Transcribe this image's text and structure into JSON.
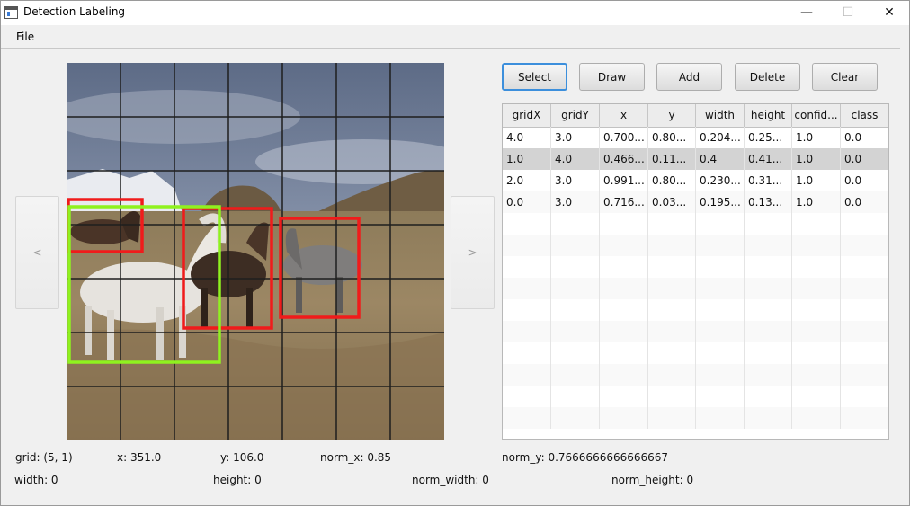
{
  "window": {
    "title": "Detection Labeling",
    "min_glyph": "—",
    "max_glyph": "☐",
    "close_glyph": "✕"
  },
  "menu": {
    "file": "File"
  },
  "nav": {
    "prev": "<",
    "next": ">"
  },
  "toolbar": {
    "select": "Select",
    "draw": "Draw",
    "add": "Add",
    "delete": "Delete",
    "clear": "Clear"
  },
  "image": {
    "description_icon": "horses-photo",
    "grid_cells": 7,
    "grid_color": "#1e1e1e",
    "selected_box_color": "#8ff21f",
    "box_color": "#f01b1b"
  },
  "table": {
    "columns": [
      "gridX",
      "gridY",
      "x",
      "y",
      "width",
      "height",
      "confid...",
      "class"
    ],
    "rows": [
      [
        "4.0",
        "3.0",
        "0.700...",
        "0.80...",
        "0.204...",
        "0.25...",
        "1.0",
        "0.0"
      ],
      [
        "1.0",
        "4.0",
        "0.466...",
        "0.11...",
        "0.4",
        "0.41...",
        "1.0",
        "0.0"
      ],
      [
        "2.0",
        "3.0",
        "0.991...",
        "0.80...",
        "0.230...",
        "0.31...",
        "1.0",
        "0.0"
      ],
      [
        "0.0",
        "3.0",
        "0.716...",
        "0.03...",
        "0.195...",
        "0.13...",
        "1.0",
        "0.0"
      ]
    ],
    "selected_row": 1
  },
  "status": {
    "grid": "grid: (5, 1)",
    "x": "x: 351.0",
    "y": "y: 106.0",
    "norm_x": "norm_x: 0.85",
    "norm_y": "norm_y: 0.7666666666666667",
    "width": "width: 0",
    "height": "height: 0",
    "norm_width": "norm_width: 0",
    "norm_height": "norm_height: 0"
  }
}
